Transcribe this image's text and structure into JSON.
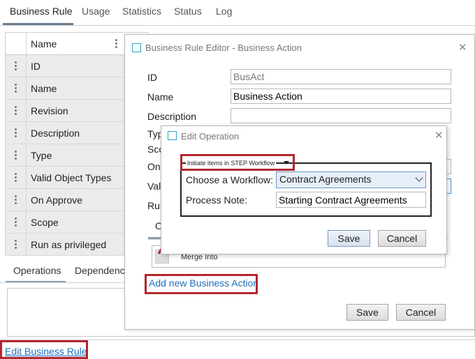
{
  "tabs": [
    "Business Rule",
    "Usage",
    "Statistics",
    "Status",
    "Log"
  ],
  "table": {
    "header": "Name",
    "rows": [
      "ID",
      "Name",
      "Revision",
      "Description",
      "Type",
      "Valid Object Types",
      "On Approve",
      "Scope",
      "Run as privileged"
    ]
  },
  "bottom_tabs": [
    "Operations",
    "Dependencies"
  ],
  "edit_rule_link": "Edit Business Rule",
  "editor": {
    "title": "Business Rule Editor - Business Action",
    "close": "✕",
    "labels": {
      "id": "ID",
      "name": "Name",
      "description": "Description",
      "type": "Type",
      "scope": "Scope",
      "on": "On Approve",
      "valid": "Valid Object Types",
      "run": "Run as privileged",
      "ops_tab": "Operations"
    },
    "id_value": "BusAct",
    "name_value": "Business Action",
    "description_value": "",
    "operation_item": "Merge Into",
    "add_action_link": "Add new Business Action",
    "save": "Save",
    "cancel": "Cancel"
  },
  "edit_operation": {
    "title": "Edit Operation",
    "close": "✕",
    "legend": "Initiate items in STEP Workflow",
    "workflow_label": "Choose a Workflow:",
    "workflow_value": "Contract Agreements",
    "note_label": "Process Note:",
    "note_value": "Starting Contract Agreements",
    "save": "Save",
    "cancel": "Cancel"
  },
  "colors": {
    "annotation_red": "#b3262e",
    "link_blue": "#1d6fb8",
    "accent_teal": "#2aa9c0"
  }
}
